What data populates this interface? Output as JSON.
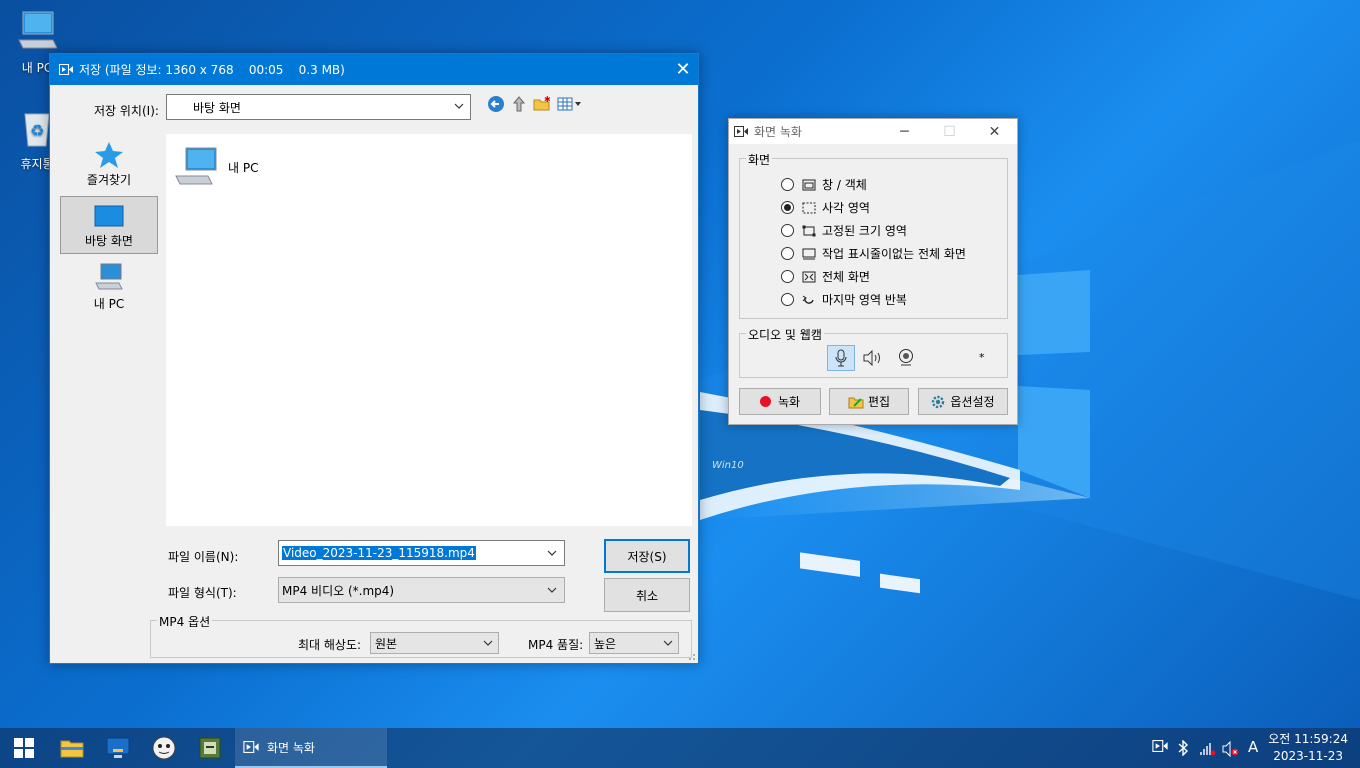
{
  "desktop": {
    "icons": [
      {
        "label": "내 PC"
      },
      {
        "label": "휴지통"
      }
    ],
    "watermark": "Win10"
  },
  "save_dialog": {
    "title": "저장 (파일 정보: 1360 x 768    00:05    0.3 MB)",
    "location_label": "저장 위치(I):",
    "location_value": "바탕 화면",
    "places": [
      "즐겨찾기",
      "바탕 화면",
      "내 PC"
    ],
    "selected_place": "바탕 화면",
    "files": [
      {
        "name": "내 PC"
      }
    ],
    "filename_label": "파일 이름(N):",
    "filename_value": "Video_2023-11-23_115918.mp4",
    "filetype_label": "파일 형식(T):",
    "filetype_value": "MP4 비디오 (*.mp4)",
    "save_button": "저장(S)",
    "cancel_button": "취소",
    "options_group": "MP4 옵션",
    "max_res_label": "최대 해상도:",
    "max_res_value": "원본",
    "quality_label": "MP4 품질:",
    "quality_value": "높은"
  },
  "recorder": {
    "title": "화면 녹화",
    "screen_group": "화면",
    "modes": [
      {
        "label": "창 / 객체",
        "selected": false
      },
      {
        "label": "사각 영역",
        "selected": true
      },
      {
        "label": "고정된 크기 영역",
        "selected": false
      },
      {
        "label": "작업 표시줄이없는 전체 화면",
        "selected": false
      },
      {
        "label": "전체 화면",
        "selected": false
      },
      {
        "label": "마지막 영역 반복",
        "selected": false
      }
    ],
    "av_group": "오디오 및 웹캠",
    "asterisk": "*",
    "record_button": "녹화",
    "edit_button": "편집",
    "options_button": "옵션설정",
    "record_color": "#e81123"
  },
  "taskbar": {
    "active_app": "화면 녹화",
    "ime": "A",
    "clock_ampm_time": "오전 11:59:24",
    "clock_date": "2023-11-23"
  }
}
